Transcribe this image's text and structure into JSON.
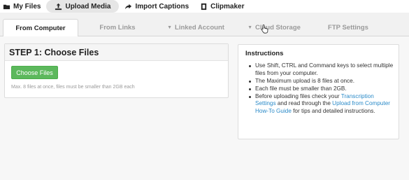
{
  "topnav": {
    "items": [
      {
        "label": "My Files",
        "icon": "folder-icon"
      },
      {
        "label": "Upload Media",
        "icon": "upload-icon"
      },
      {
        "label": "Import Captions",
        "icon": "share-arrow-icon"
      },
      {
        "label": "Clipmaker",
        "icon": "film-icon"
      }
    ],
    "active_index": 1
  },
  "tabs": [
    {
      "label": "From Computer",
      "active": true,
      "has_caret": false
    },
    {
      "label": "From Links",
      "active": false,
      "has_caret": false
    },
    {
      "label": "Linked Account",
      "active": false,
      "has_caret": true
    },
    {
      "label": "Cloud Storage",
      "active": false,
      "has_caret": true
    },
    {
      "label": "FTP Settings",
      "active": false,
      "has_caret": false
    }
  ],
  "step": {
    "title": "STEP 1: Choose Files",
    "button_label": "Choose Files",
    "note": "Max. 8 files at once, files must be smaller than 2GB each"
  },
  "instructions": {
    "title": "Instructions",
    "item1": "Use Shift, CTRL and Command keys to select multiple files from your computer.",
    "item2": "The Maximum upload is 8 files at once.",
    "item3": "Each file must be smaller than 2GB.",
    "item4_pre": "Before uploading files check your ",
    "item4_link1": "Transcription Settings",
    "item4_mid": " and read through the ",
    "item4_link2": "Upload from Computer How-To Guide",
    "item4_post": " for tips and detailed instructions."
  },
  "colors": {
    "accent_green": "#5cb85c",
    "link_blue": "#2a8ac8"
  }
}
